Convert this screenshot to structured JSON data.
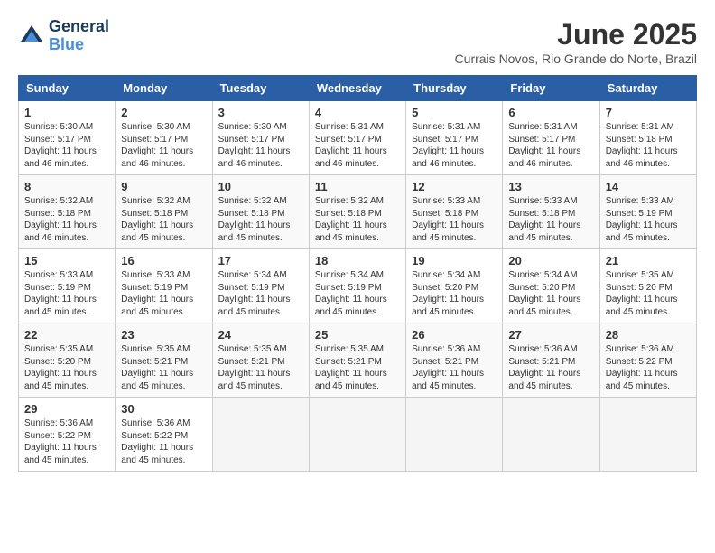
{
  "logo": {
    "line1": "General",
    "line2": "Blue"
  },
  "title": "June 2025",
  "subtitle": "Currais Novos, Rio Grande do Norte, Brazil",
  "weekdays": [
    "Sunday",
    "Monday",
    "Tuesday",
    "Wednesday",
    "Thursday",
    "Friday",
    "Saturday"
  ],
  "weeks": [
    [
      {
        "num": "1",
        "sunrise": "5:30 AM",
        "sunset": "5:17 PM",
        "daylight": "11 hours and 46 minutes."
      },
      {
        "num": "2",
        "sunrise": "5:30 AM",
        "sunset": "5:17 PM",
        "daylight": "11 hours and 46 minutes."
      },
      {
        "num": "3",
        "sunrise": "5:30 AM",
        "sunset": "5:17 PM",
        "daylight": "11 hours and 46 minutes."
      },
      {
        "num": "4",
        "sunrise": "5:31 AM",
        "sunset": "5:17 PM",
        "daylight": "11 hours and 46 minutes."
      },
      {
        "num": "5",
        "sunrise": "5:31 AM",
        "sunset": "5:17 PM",
        "daylight": "11 hours and 46 minutes."
      },
      {
        "num": "6",
        "sunrise": "5:31 AM",
        "sunset": "5:17 PM",
        "daylight": "11 hours and 46 minutes."
      },
      {
        "num": "7",
        "sunrise": "5:31 AM",
        "sunset": "5:18 PM",
        "daylight": "11 hours and 46 minutes."
      }
    ],
    [
      {
        "num": "8",
        "sunrise": "5:32 AM",
        "sunset": "5:18 PM",
        "daylight": "11 hours and 46 minutes."
      },
      {
        "num": "9",
        "sunrise": "5:32 AM",
        "sunset": "5:18 PM",
        "daylight": "11 hours and 45 minutes."
      },
      {
        "num": "10",
        "sunrise": "5:32 AM",
        "sunset": "5:18 PM",
        "daylight": "11 hours and 45 minutes."
      },
      {
        "num": "11",
        "sunrise": "5:32 AM",
        "sunset": "5:18 PM",
        "daylight": "11 hours and 45 minutes."
      },
      {
        "num": "12",
        "sunrise": "5:33 AM",
        "sunset": "5:18 PM",
        "daylight": "11 hours and 45 minutes."
      },
      {
        "num": "13",
        "sunrise": "5:33 AM",
        "sunset": "5:18 PM",
        "daylight": "11 hours and 45 minutes."
      },
      {
        "num": "14",
        "sunrise": "5:33 AM",
        "sunset": "5:19 PM",
        "daylight": "11 hours and 45 minutes."
      }
    ],
    [
      {
        "num": "15",
        "sunrise": "5:33 AM",
        "sunset": "5:19 PM",
        "daylight": "11 hours and 45 minutes."
      },
      {
        "num": "16",
        "sunrise": "5:33 AM",
        "sunset": "5:19 PM",
        "daylight": "11 hours and 45 minutes."
      },
      {
        "num": "17",
        "sunrise": "5:34 AM",
        "sunset": "5:19 PM",
        "daylight": "11 hours and 45 minutes."
      },
      {
        "num": "18",
        "sunrise": "5:34 AM",
        "sunset": "5:19 PM",
        "daylight": "11 hours and 45 minutes."
      },
      {
        "num": "19",
        "sunrise": "5:34 AM",
        "sunset": "5:20 PM",
        "daylight": "11 hours and 45 minutes."
      },
      {
        "num": "20",
        "sunrise": "5:34 AM",
        "sunset": "5:20 PM",
        "daylight": "11 hours and 45 minutes."
      },
      {
        "num": "21",
        "sunrise": "5:35 AM",
        "sunset": "5:20 PM",
        "daylight": "11 hours and 45 minutes."
      }
    ],
    [
      {
        "num": "22",
        "sunrise": "5:35 AM",
        "sunset": "5:20 PM",
        "daylight": "11 hours and 45 minutes."
      },
      {
        "num": "23",
        "sunrise": "5:35 AM",
        "sunset": "5:21 PM",
        "daylight": "11 hours and 45 minutes."
      },
      {
        "num": "24",
        "sunrise": "5:35 AM",
        "sunset": "5:21 PM",
        "daylight": "11 hours and 45 minutes."
      },
      {
        "num": "25",
        "sunrise": "5:35 AM",
        "sunset": "5:21 PM",
        "daylight": "11 hours and 45 minutes."
      },
      {
        "num": "26",
        "sunrise": "5:36 AM",
        "sunset": "5:21 PM",
        "daylight": "11 hours and 45 minutes."
      },
      {
        "num": "27",
        "sunrise": "5:36 AM",
        "sunset": "5:21 PM",
        "daylight": "11 hours and 45 minutes."
      },
      {
        "num": "28",
        "sunrise": "5:36 AM",
        "sunset": "5:22 PM",
        "daylight": "11 hours and 45 minutes."
      }
    ],
    [
      {
        "num": "29",
        "sunrise": "5:36 AM",
        "sunset": "5:22 PM",
        "daylight": "11 hours and 45 minutes."
      },
      {
        "num": "30",
        "sunrise": "5:36 AM",
        "sunset": "5:22 PM",
        "daylight": "11 hours and 45 minutes."
      },
      null,
      null,
      null,
      null,
      null
    ]
  ]
}
